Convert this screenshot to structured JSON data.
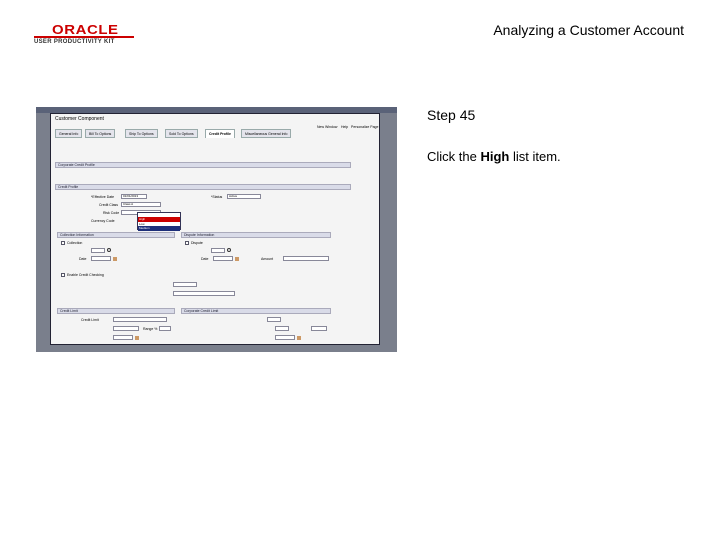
{
  "slide": {
    "title": "Analyzing a Customer Account",
    "logo_text": "ORACLE",
    "logo_sub": "USER PRODUCTIVITY KIT"
  },
  "step": {
    "label": "Step 45",
    "instruction_before": "Click the ",
    "instruction_bold": "High",
    "instruction_after": " list item."
  },
  "screenshot": {
    "window_title": "Customer Component",
    "tabs": [
      "General Info",
      "Bill To Options",
      "Ship To Options",
      "Sold To Options",
      "Credit Profile",
      "Miscellaneous General Info"
    ],
    "active_tab": "Credit Profile",
    "links": [
      "New Window",
      "Help",
      "Personalize Page"
    ],
    "sections": {
      "corporate": "Corporate Credit Profile",
      "credit_profile": "Credit Profile",
      "collection": "Collection Information",
      "dispute": "Dispute Information",
      "credit_limit": "Credit Limit",
      "corp_credit_limit": "Corporate Credit Limit"
    },
    "fields": {
      "effective_date_label": "*Effective Date",
      "effective_date": "01/01/2013",
      "status_label": "*Status",
      "status": "Active",
      "credit_class_label": "Credit Class",
      "credit_class": "Class A",
      "risk_code_label": "Risk Code",
      "currency_code_label": "Currency Code",
      "date_label": "Date",
      "amount_label": "Amount",
      "enable_credit_checking": "Enable Credit Checking",
      "credit_limit_label": "Credit Limit",
      "range_label": "Range %"
    },
    "dropdown_options": [
      "",
      "High",
      "Low",
      "Medium"
    ],
    "dropdown_highlight": "High",
    "dropdown_selected": "Medium",
    "checkboxes": {
      "collection": "Collection",
      "dispute": "Dispute"
    }
  }
}
